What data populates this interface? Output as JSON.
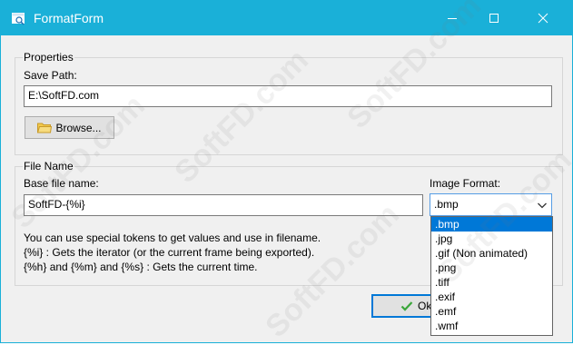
{
  "window": {
    "title": "FormatForm",
    "controls": [
      "minimize",
      "maximize",
      "close"
    ]
  },
  "properties": {
    "group_title": "Properties",
    "save_path_label": "Save Path:",
    "save_path_value": "E:\\SoftFD.com",
    "browse_label": "Browse..."
  },
  "file_name": {
    "group_title": "File Name",
    "base_label": "Base file name:",
    "base_value": "SoftFD-{%i}",
    "hint_lines": [
      "You can use special tokens to get values and use in filename.",
      "{%i} : Gets the iterator (or the current frame being exported).",
      "{%h} and {%m} and {%s} : Gets the current time."
    ]
  },
  "image_format": {
    "label": "Image Format:",
    "selected": ".bmp",
    "options": [
      ".bmp",
      ".jpg",
      ".gif (Non animated)",
      ".png",
      ".tiff",
      ".exif",
      ".emf",
      ".wmf"
    ]
  },
  "footer": {
    "ok_label": "Ok"
  },
  "watermark": "SoftFD.com",
  "colors": {
    "titlebar": "#1ab0d8",
    "selection": "#0078d7",
    "focus_border": "#569de5"
  },
  "icons": {
    "app": "form-icon",
    "browse": "folder-icon",
    "ok": "checkmark-icon",
    "combo": "chevron-down-icon"
  }
}
